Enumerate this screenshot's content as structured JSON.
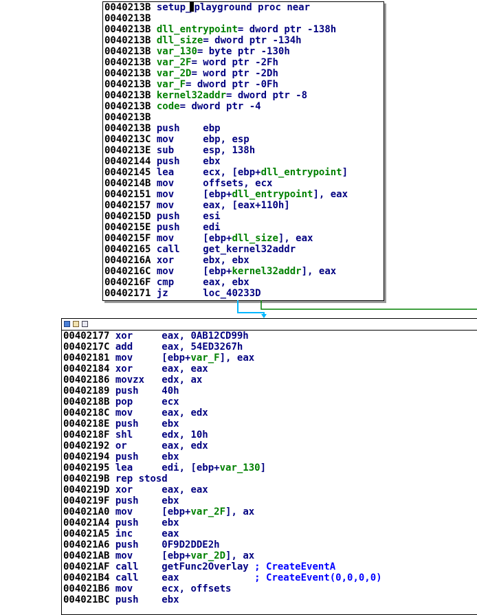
{
  "colors": {
    "address": "#000000",
    "mnemonic": "#000080",
    "operand_name": "#008000",
    "comment": "#0000ff",
    "edge_green": "#008000",
    "edge_cyan": "#00b7ff"
  },
  "icons": [
    "graph-view-icon",
    "edit-icon",
    "comment-icon"
  ],
  "block1": {
    "lines": [
      {
        "addr": "0040213B",
        "text": " setup_playground proc near"
      },
      {
        "addr": "0040213B",
        "text": ""
      },
      {
        "addr": "0040213B",
        "text": " dll_entrypoint= dword ptr -138h"
      },
      {
        "addr": "0040213B",
        "text": " dll_size= dword ptr -134h"
      },
      {
        "addr": "0040213B",
        "text": " var_130= byte ptr -130h"
      },
      {
        "addr": "0040213B",
        "text": " var_2F= word ptr -2Fh"
      },
      {
        "addr": "0040213B",
        "text": " var_2D= word ptr -2Dh"
      },
      {
        "addr": "0040213B",
        "text": " var_F= dword ptr -0Fh"
      },
      {
        "addr": "0040213B",
        "text": " kernel32addr= dword ptr -8"
      },
      {
        "addr": "0040213B",
        "text": " code= dword ptr -4"
      },
      {
        "addr": "0040213B",
        "text": ""
      },
      {
        "addr": "0040213B",
        "text": " push    ebp"
      },
      {
        "addr": "0040213C",
        "text": " mov     ebp, esp"
      },
      {
        "addr": "0040213E",
        "text": " sub     esp, 138h"
      },
      {
        "addr": "00402144",
        "text": " push    ebx"
      },
      {
        "addr": "00402145",
        "text": " lea     ecx, [ebp+dll_entrypoint]"
      },
      {
        "addr": "0040214B",
        "text": " mov     offsets, ecx"
      },
      {
        "addr": "00402151",
        "text": " mov     [ebp+dll_entrypoint], eax"
      },
      {
        "addr": "00402157",
        "text": " mov     eax, [eax+110h]"
      },
      {
        "addr": "0040215D",
        "text": " push    esi"
      },
      {
        "addr": "0040215E",
        "text": " push    edi"
      },
      {
        "addr": "0040215F",
        "text": " mov     [ebp+dll_size], eax"
      },
      {
        "addr": "00402165",
        "text": " call    get_kernel32addr"
      },
      {
        "addr": "0040216A",
        "text": " xor     ebx, ebx"
      },
      {
        "addr": "0040216C",
        "text": " mov     [ebp+kernel32addr], eax"
      },
      {
        "addr": "0040216F",
        "text": " cmp     eax, ebx"
      },
      {
        "addr": "00402171",
        "text": " jz      loc_40233D"
      }
    ]
  },
  "block2": {
    "lines": [
      {
        "addr": "00402177",
        "text": " xor     eax, 0AB12CD99h"
      },
      {
        "addr": "0040217C",
        "text": " add     eax, 54ED3267h"
      },
      {
        "addr": "00402181",
        "text": " mov     [ebp+var_F], eax"
      },
      {
        "addr": "00402184",
        "text": " xor     eax, eax"
      },
      {
        "addr": "00402186",
        "text": " movzx   edx, ax"
      },
      {
        "addr": "00402189",
        "text": " push    40h"
      },
      {
        "addr": "0040218B",
        "text": " pop     ecx"
      },
      {
        "addr": "0040218C",
        "text": " mov     eax, edx"
      },
      {
        "addr": "0040218E",
        "text": " push    ebx"
      },
      {
        "addr": "0040218F",
        "text": " shl     edx, 10h"
      },
      {
        "addr": "00402192",
        "text": " or      eax, edx"
      },
      {
        "addr": "00402194",
        "text": " push    ebx"
      },
      {
        "addr": "00402195",
        "text": " lea     edi, [ebp+var_130]"
      },
      {
        "addr": "0040219B",
        "text": " rep stosd"
      },
      {
        "addr": "0040219D",
        "text": " xor     eax, eax"
      },
      {
        "addr": "0040219F",
        "text": " push    ebx"
      },
      {
        "addr": "004021A0",
        "text": " mov     [ebp+var_2F], ax"
      },
      {
        "addr": "004021A4",
        "text": " push    ebx"
      },
      {
        "addr": "004021A5",
        "text": " inc     eax"
      },
      {
        "addr": "004021A6",
        "text": " push    0F9D2DDE2h"
      },
      {
        "addr": "004021AB",
        "text": " mov     [ebp+var_2D], ax"
      },
      {
        "addr": "004021AF",
        "text": " call    getFunc2Overlay ; CreateEventA"
      },
      {
        "addr": "004021B4",
        "text": " call    eax             ; CreateEvent(0,0,0,0)"
      },
      {
        "addr": "004021B6",
        "text": " mov     ecx, offsets"
      },
      {
        "addr": "004021BC",
        "text": " push    ebx"
      }
    ]
  }
}
